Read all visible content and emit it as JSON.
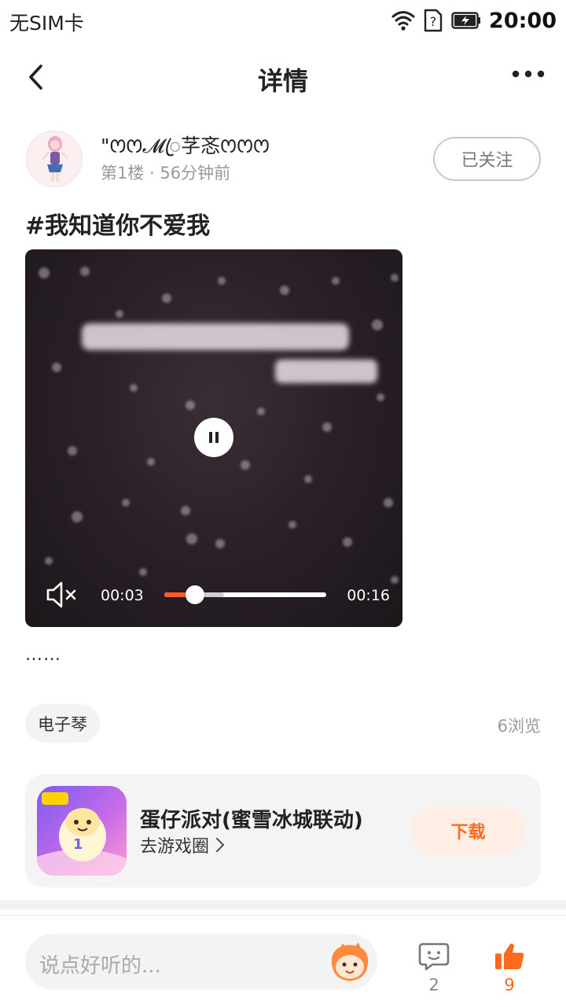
{
  "status_bar": {
    "sim": "无SIM卡",
    "time": "20:00",
    "icons": [
      "wifi-icon",
      "no-sim-question-icon",
      "battery-charging-icon"
    ]
  },
  "nav": {
    "title": "详情",
    "back_icon": "chevron-left-icon",
    "more_icon": "more-dots-icon"
  },
  "author": {
    "name": "\"ꯁꯁ𝓜ꦿ芓忞ꯁꯁꯁ",
    "meta": "第1楼 · 56分钟前",
    "follow_label": "已关注"
  },
  "post": {
    "title": "#我知道你不爱我",
    "body": "……"
  },
  "video": {
    "current_time": "00:03",
    "total_time": "00:16",
    "progress_fraction": 0.1875,
    "buffered_fraction": 0.37,
    "state": "playing",
    "muted": true
  },
  "tag": {
    "label": "电子琴",
    "views": "6浏览"
  },
  "game": {
    "name": "蛋仔派对(蜜雪冰城联动)",
    "link_label": "去游戏圈",
    "download_label": "下载"
  },
  "bottom_bar": {
    "comment_placeholder": "说点好听的...",
    "comment_count": "2",
    "like_count": "9"
  },
  "colors": {
    "accent": "#ff6a1f",
    "accent_light": "#ffeee3",
    "progress": "#ff5a1f"
  }
}
